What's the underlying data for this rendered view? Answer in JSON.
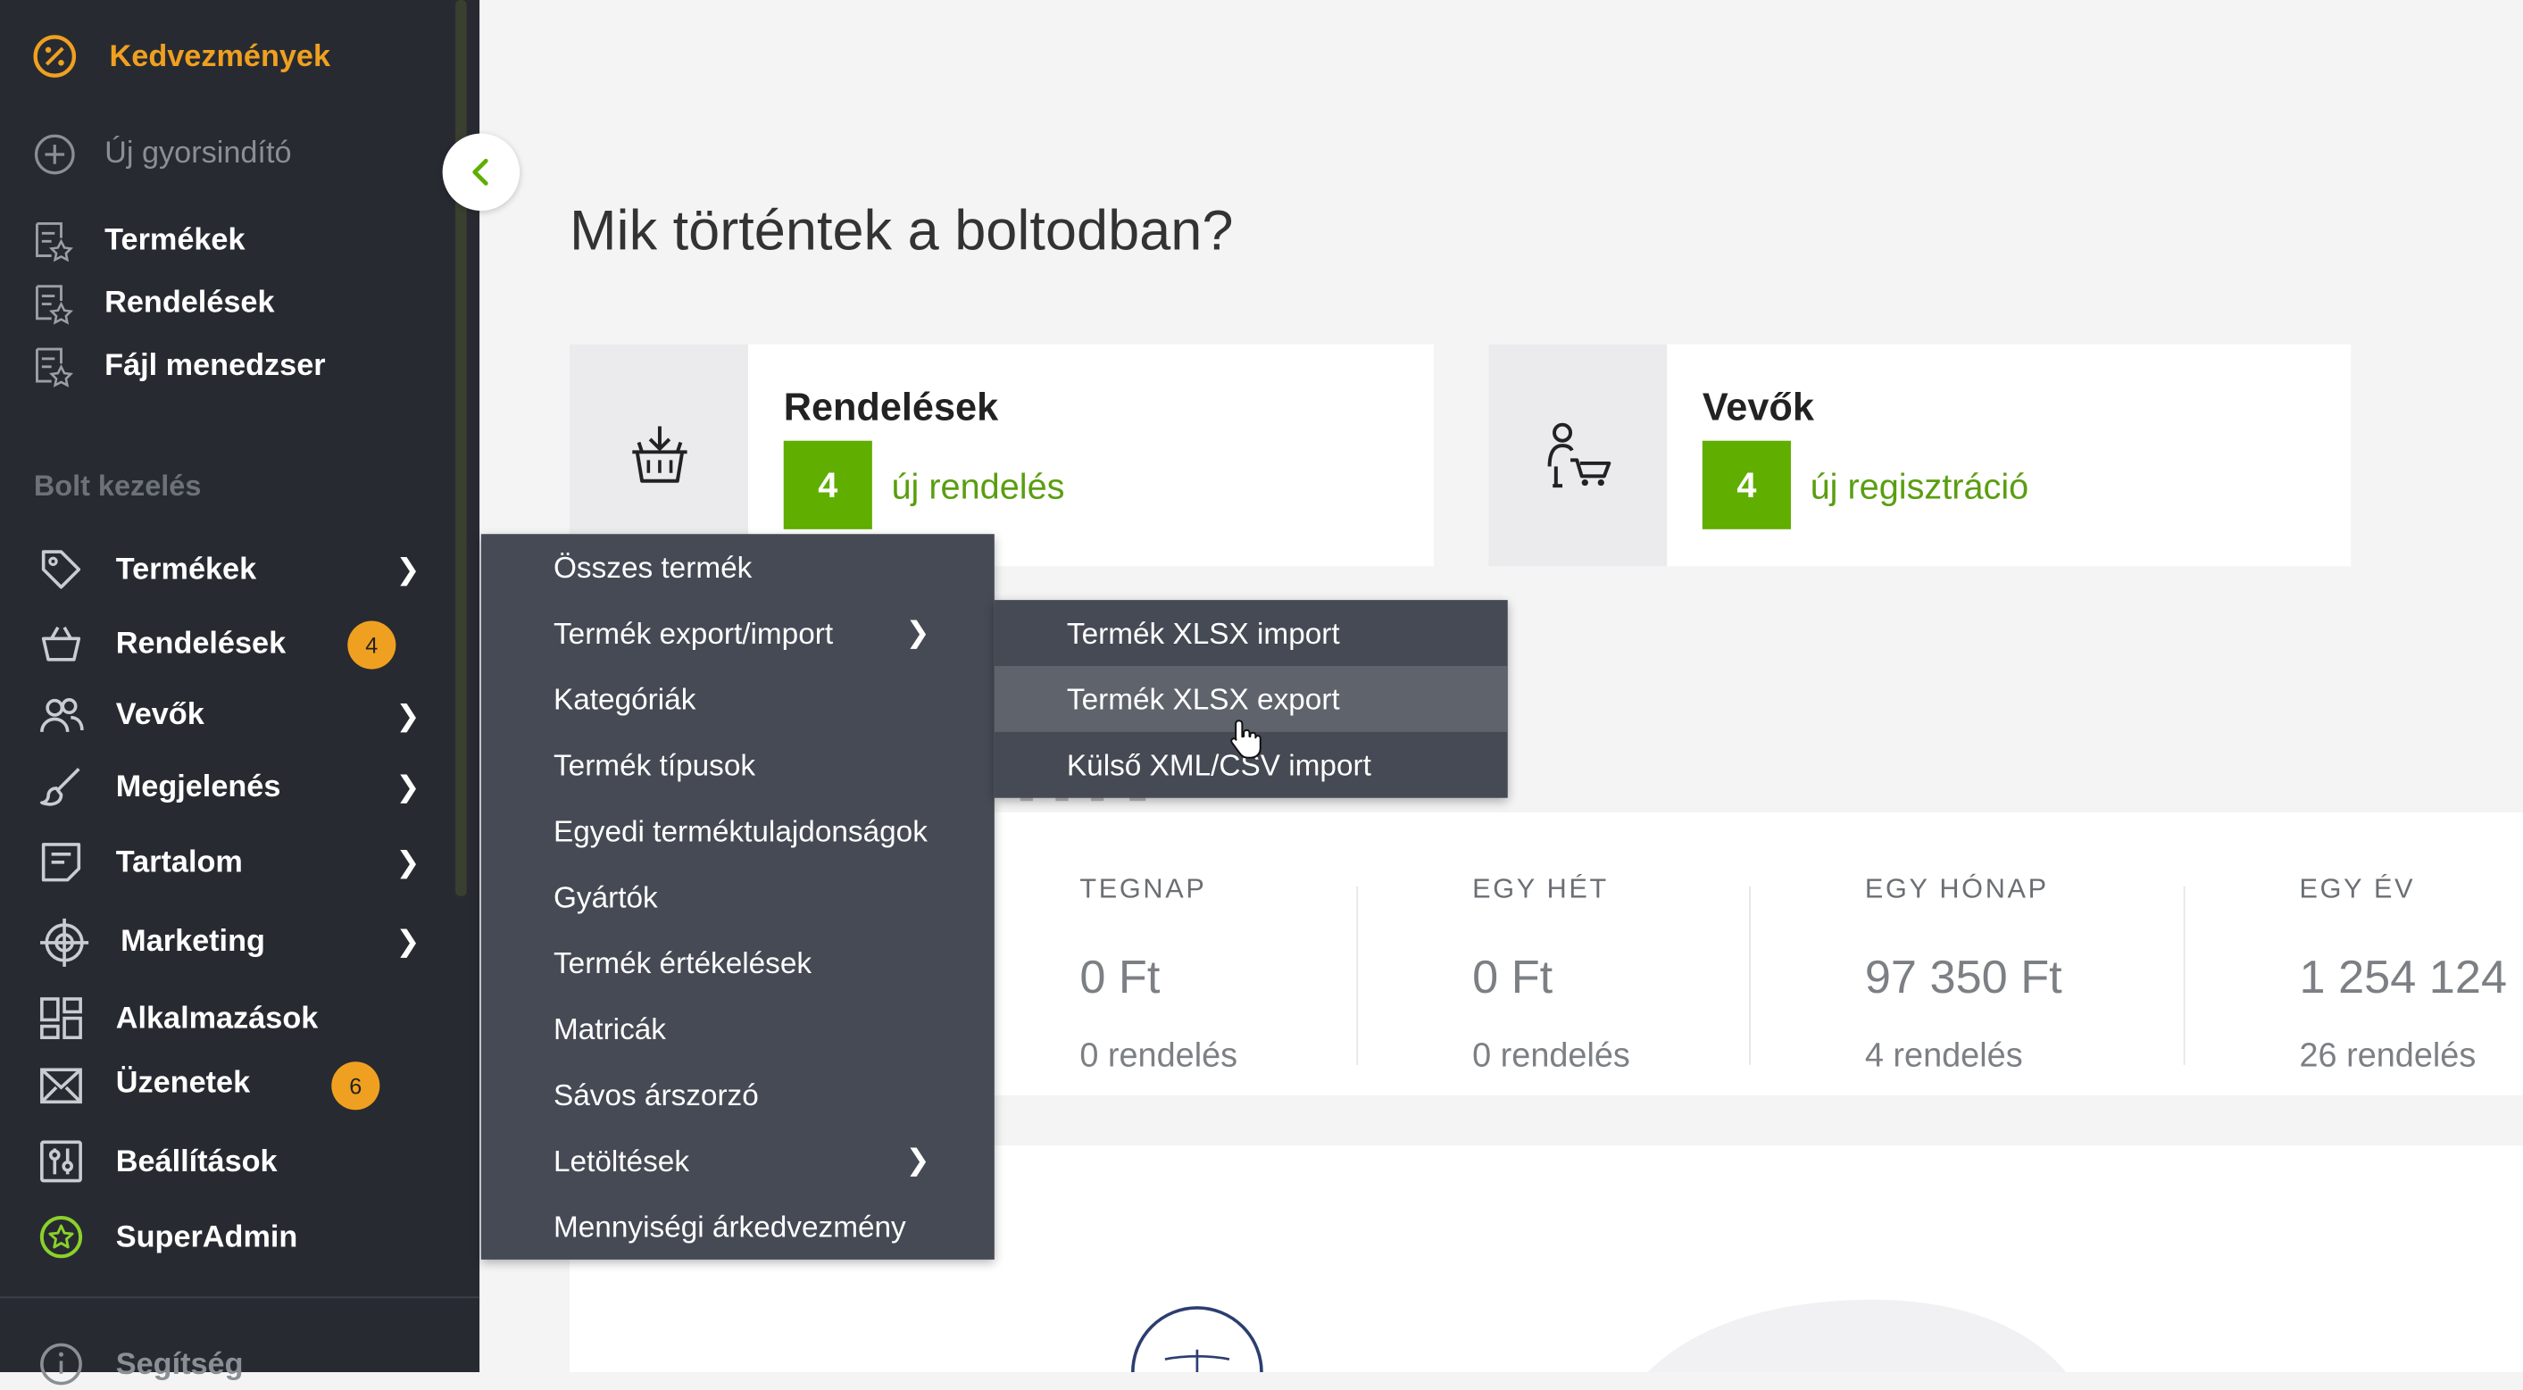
{
  "sidebar": {
    "top_items": [
      {
        "label": "Kedvezmények",
        "icon": "percent-circle-icon"
      },
      {
        "label": "Új gyorsindító",
        "icon": "plus-circle-icon"
      }
    ],
    "quick_items": [
      {
        "label": "Termékek",
        "icon": "list-star-icon"
      },
      {
        "label": "Rendelések",
        "icon": "list-star-icon"
      },
      {
        "label": "Fájl menedzser",
        "icon": "list-star-icon"
      }
    ],
    "section_title": "Bolt kezelés",
    "nav_items": [
      {
        "label": "Termékek",
        "icon": "tag-icon",
        "chevron": true
      },
      {
        "label": "Rendelések",
        "icon": "basket-icon",
        "badge": "4"
      },
      {
        "label": "Vevők",
        "icon": "users-icon",
        "chevron": true
      },
      {
        "label": "Megjelenés",
        "icon": "brush-icon",
        "chevron": true
      },
      {
        "label": "Tartalom",
        "icon": "document-icon",
        "chevron": true
      },
      {
        "label": "Marketing",
        "icon": "target-icon",
        "chevron": true
      },
      {
        "label": "Alkalmazások",
        "icon": "apps-grid-icon"
      },
      {
        "label": "Üzenetek",
        "icon": "envelope-icon",
        "badge": "6"
      },
      {
        "label": "Beállítások",
        "icon": "sliders-icon"
      },
      {
        "label": "SuperAdmin",
        "icon": "star-circle-icon"
      }
    ],
    "help_label": "Segítség",
    "collapse_icon": "chevron-left-icon"
  },
  "main": {
    "title": "Mik történtek a boltodban?",
    "cards": [
      {
        "title": "Rendelések",
        "count": "4",
        "text": "új rendelés",
        "icon": "basket-download-icon"
      },
      {
        "title": "Vevők",
        "count": "4",
        "text": "új regisztráció",
        "icon": "person-cart-icon"
      }
    ],
    "stats": [
      {
        "label": "TEGNAP",
        "value": "0 Ft",
        "orders": "0 rendelés"
      },
      {
        "label": "EGY HÉT",
        "value": "0 Ft",
        "orders": "0 rendelés"
      },
      {
        "label": "EGY HÓNAP",
        "value": "97 350 Ft",
        "orders": "4 rendelés"
      },
      {
        "label": "EGY ÉV",
        "value": "1 254 124",
        "orders": "26 rendelés"
      }
    ]
  },
  "menu": {
    "items": [
      {
        "label": "Összes termék"
      },
      {
        "label": "Termék export/import",
        "chevron": true
      },
      {
        "label": "Kategóriák"
      },
      {
        "label": "Termék típusok"
      },
      {
        "label": "Egyedi terméktulajdonságok"
      },
      {
        "label": "Gyártók"
      },
      {
        "label": "Termék értékelések"
      },
      {
        "label": "Matricák"
      },
      {
        "label": "Sávos árszorzó"
      },
      {
        "label": "Letöltések",
        "chevron": true
      },
      {
        "label": "Mennyiségi árkedvezmény"
      }
    ],
    "submenu": [
      {
        "label": "Termék XLSX import"
      },
      {
        "label": "Termék XLSX export",
        "highlighted": true
      },
      {
        "label": "Külső XML/CSV import"
      }
    ]
  },
  "colors": {
    "sidebar": "#272b31",
    "accent_orange": "#f0a020",
    "accent_green": "#5fae00",
    "menu_bg": "#454a54",
    "menu_highlight": "#5e636c"
  }
}
